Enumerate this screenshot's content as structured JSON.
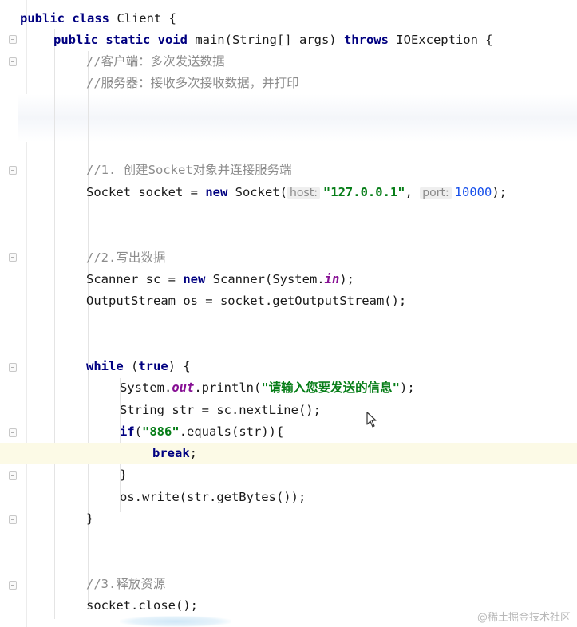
{
  "editor": {
    "lines": {
      "l1": {
        "kw1": "public class",
        "text": " Client {"
      },
      "l2": {
        "kw1": "public static void",
        "text": " main(String[] args) ",
        "kw2": "throws",
        "text2": " IOException {"
      },
      "l3": {
        "comment": "//客户端：多次发送数据"
      },
      "l4": {
        "comment": "//服务器：接收多次接收数据，并打印"
      },
      "l5": {
        "comment": "//1. 创建Socket对象并连接服务端"
      },
      "l6": {
        "text": "Socket socket = ",
        "kw": "new",
        "text2": " Socket(",
        "hint1": "host:",
        "str": "\"127.0.0.1\"",
        "text3": ", ",
        "hint2": "port:",
        "num": "10000",
        "text4": ");"
      },
      "l7": {
        "comment": "//2.写出数据"
      },
      "l8": {
        "text": "Scanner sc = ",
        "kw": "new",
        "text2": " Scanner(System.",
        "field": "in",
        "text3": ");"
      },
      "l9": {
        "text": "OutputStream os = socket.getOutputStream();"
      },
      "l10": {
        "kw": "while",
        "text": " (",
        "kw2": "true",
        "text2": ") {"
      },
      "l11": {
        "text": "System.",
        "field": "out",
        "text2": ".println(",
        "str": "\"请输入您要发送的信息\"",
        "text3": ");"
      },
      "l12": {
        "text": "String str = sc.nextLine();"
      },
      "l13": {
        "kw": "if",
        "text": "(",
        "str": "\"886\"",
        "text2": ".equals(str)){"
      },
      "l14": {
        "kw": "break",
        "text": ";"
      },
      "l15": {
        "text": "}"
      },
      "l16": {
        "text": "os.write(str.getBytes());"
      },
      "l17": {
        "text": "}"
      },
      "l18": {
        "comment": "//3.释放资源"
      },
      "l19": {
        "text": "socket.close();"
      }
    }
  },
  "watermark": "@稀土掘金技术社区",
  "icons": {
    "cursor": "mouse-pointer-icon",
    "fold": "fold-marker-icon"
  }
}
